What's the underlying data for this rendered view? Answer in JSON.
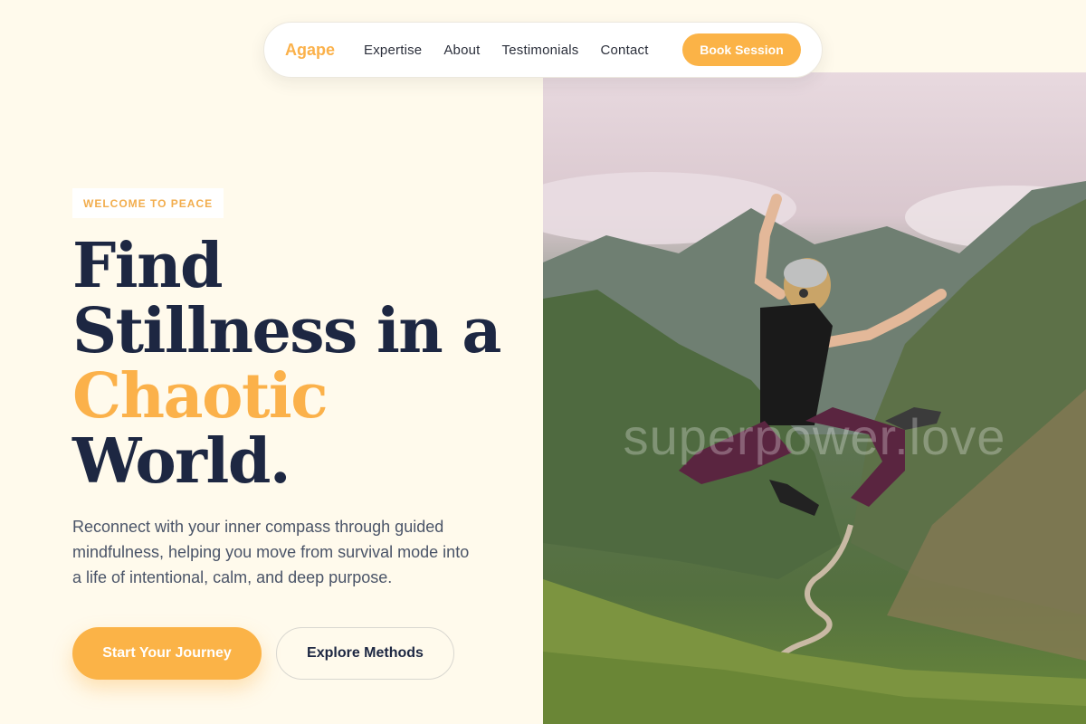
{
  "nav": {
    "brand": "Agape",
    "links": [
      "Expertise",
      "About",
      "Testimonials",
      "Contact"
    ],
    "cta": "Book Session"
  },
  "hero": {
    "eyebrow": "WELCOME TO PEACE",
    "headline": {
      "line1": "Find",
      "line2": "Stillness in a",
      "accent": "Chaotic",
      "line4": "World."
    },
    "description": "Reconnect with your inner compass through guided mindfulness, helping you move from survival mode into a life of intentional, calm, and deep purpose.",
    "primary_button": "Start Your Journey",
    "secondary_button": "Explore Methods"
  },
  "image": {
    "watermark": "superpower.love"
  },
  "colors": {
    "accent": "#fbb347",
    "navy": "#1d2742",
    "background": "#fffaec"
  }
}
